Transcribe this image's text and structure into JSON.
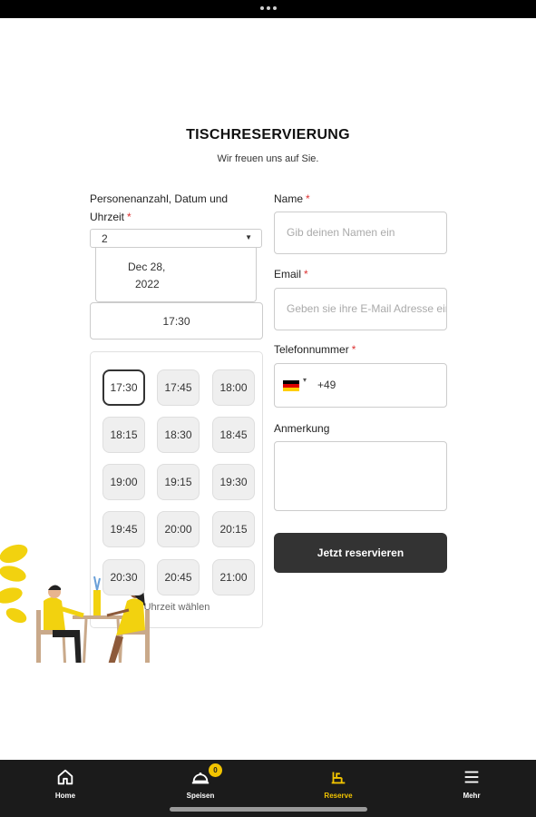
{
  "header": {
    "title": "TISCHRESERVIERUNG",
    "subtitle": "Wir freuen uns auf Sie."
  },
  "left": {
    "label": "Personenanzahl, Datum und Uhrzeit",
    "required_mark": "*",
    "persons_value": "2",
    "date_line1": "Dec 28,",
    "date_line2": "2022",
    "time_value": "17:30",
    "time_slots": [
      "17:30",
      "17:45",
      "18:00",
      "18:15",
      "18:30",
      "18:45",
      "19:00",
      "19:15",
      "19:30",
      "19:45",
      "20:00",
      "20:15",
      "20:30",
      "20:45",
      "21:00"
    ],
    "selected_slot": "17:30",
    "slot_hint": "Uhrzeit wählen"
  },
  "form": {
    "name_label": "Name",
    "name_placeholder": "Gib deinen Namen ein",
    "email_label": "Email",
    "email_placeholder": "Geben sie ihre E-Mail Adresse ein",
    "phone_label": "Telefonnummer",
    "phone_code": "+49",
    "note_label": "Anmerkung",
    "submit_label": "Jetzt reservieren"
  },
  "nav": {
    "items": [
      {
        "label": "Home",
        "icon": "home-icon"
      },
      {
        "label": "Speisen",
        "icon": "cloche-icon"
      },
      {
        "label": "Reserve",
        "icon": "reserve-icon"
      },
      {
        "label": "Mehr",
        "icon": "menu-icon"
      }
    ],
    "active": "Reserve",
    "cart_count": "0"
  },
  "colors": {
    "accent": "#f2c400",
    "button": "#333333",
    "navbar": "#1b1b1b",
    "required": "#dd3333",
    "flag_black": "#000000",
    "flag_red": "#dd0000",
    "flag_gold": "#ffce00"
  }
}
